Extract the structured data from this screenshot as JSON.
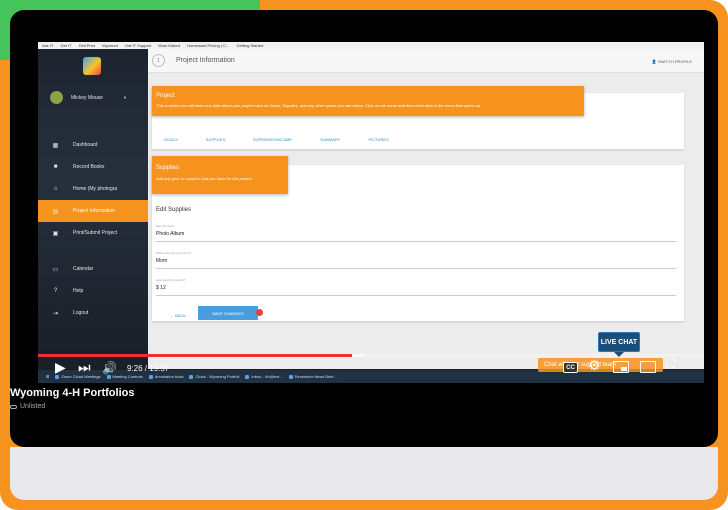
{
  "browser": {
    "bookmarks": [
      "Ask IT",
      "Get IT",
      "Dell Print",
      "Wyomed",
      "Get IT Support",
      "Most Visited",
      "Homeward Pricing | C...",
      "Getting Started"
    ]
  },
  "app": {
    "sidebar": {
      "user_name": "Mickey Mouse",
      "nav_items": [
        {
          "label": "Dashboard",
          "icon": "dashboard-icon"
        },
        {
          "label": "Record Books",
          "icon": "book-icon"
        },
        {
          "label": "Home (My photogra",
          "icon": "home-icon"
        },
        {
          "label": "Project Information",
          "icon": "grid-icon",
          "active": true
        },
        {
          "label": "Print/Submit Project",
          "icon": "print-icon"
        },
        {
          "label": "Calendar",
          "icon": "calendar-icon"
        },
        {
          "label": "Help",
          "icon": "help-icon"
        },
        {
          "label": "Logout",
          "icon": "logout-icon"
        }
      ]
    },
    "topbar": {
      "step": "1",
      "title": "Project Information",
      "switch_profile": "SWITCH PROFILE"
    },
    "project_card": {
      "title": "Project",
      "description": "This is where you will enter any data about your project such as Goals, Supplies, and any other option you see below. Click on the name and then enter data in the menu that opens up",
      "tabs": [
        "GOALS",
        "SUPPLIES",
        "EXPENSES/INCOME",
        "SUMMARY",
        "PICTURES"
      ]
    },
    "supplies_card": {
      "title": "Supplies",
      "description": "Add any gear or supplies that you have for this project",
      "edit_title": "Edit Supplies",
      "fields": [
        {
          "label": "Item for need",
          "value": "Photo Album"
        },
        {
          "label": "Where did you get it from?",
          "value": "Mom"
        },
        {
          "label": "How much is it worth?",
          "value": "$  12"
        }
      ],
      "back_label": "BACK",
      "save_label": "SAVE CHANGES"
    },
    "taskbar": [
      "Zoom Cloud Meetings",
      "Meeting Controls",
      "Annotation tools",
      "Clubs - Wyoming Portfoli",
      "Inbox - 4H@ext...",
      "December News Brief..."
    ]
  },
  "player": {
    "current_time": "9:26",
    "duration": "19:57",
    "time_display": "9:26 / 19:57",
    "progress_fraction": 0.472,
    "buffered_fraction": 0.49,
    "live_chat": "LIVE CHAT",
    "chat_bubble": "Chat with our support team",
    "cc_label": "CC"
  },
  "video": {
    "title": "Wyoming 4-H Portfolios",
    "visibility": "Unlisted"
  },
  "colors": {
    "orange": "#f6921e",
    "green": "#46c35a",
    "red_progress": "#f03030",
    "link_blue": "#2a8fd1"
  }
}
